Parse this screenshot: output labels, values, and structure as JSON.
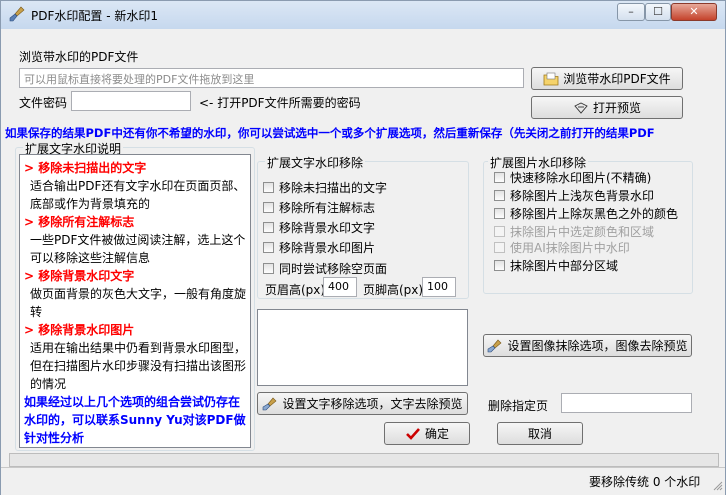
{
  "window": {
    "title": "PDF水印配置 - 新水印1",
    "controls": {
      "minimize": "–",
      "maximize": "☐",
      "close": "✕"
    }
  },
  "file": {
    "label": "浏览带水印的PDF文件",
    "placeholder": "可以用鼠标直接将要处理的PDF文件拖放到这里",
    "browse_button": "浏览带水印PDF文件",
    "password_label": "文件密码",
    "password_value": "",
    "password_hint": "<- 打开PDF文件所需要的密码",
    "preview_button": "打开预览"
  },
  "banner": "如果保存的结果PDF中还有你不希望的水印，你可以尝试选中一个或多个扩展选项，然后重新保存（先关闭之前打开的结果PDF",
  "description": {
    "group_title": "扩展文字水印说明",
    "sections": [
      {
        "heading": "> 移除未扫描出的文字",
        "text": "适合输出PDF还有文字水印在页面页部、底部或作为背景填充的"
      },
      {
        "heading": "> 移除所有注解标志",
        "text": "一些PDF文件被做过阅读注解，选上这个可以移除这些注解信息"
      },
      {
        "heading": "> 移除背景水印文字",
        "text": "做页面背景的灰色大文字，一般有角度旋转"
      },
      {
        "heading": "> 移除背景水印图片",
        "text": "适用在输出结果中仍看到背景水印图型，但在扫描图片水印步骤没有扫描出该图形的情况"
      }
    ],
    "contact": "如果经过以上几个选项的组合尝试仍存在水印的，可以联系Sunny Yu对该PDF做针对性分析"
  },
  "text_options": {
    "group_title": "扩展文字水印移除",
    "items": [
      {
        "label": "移除未扫描出的文字",
        "checked": false
      },
      {
        "label": "移除所有注解标志",
        "checked": false
      },
      {
        "label": "移除背景水印文字",
        "checked": false
      },
      {
        "label": "移除背景水印图片",
        "checked": false
      },
      {
        "label": "同时尝试移除空页面",
        "checked": false
      }
    ],
    "header_label": "页眉高(px)",
    "header_value": "400",
    "footer_label": "页脚高(px)",
    "footer_value": "100",
    "preview_button": "设置文字移除选项，文字去除预览"
  },
  "image_options": {
    "group_title": "扩展图片水印移除",
    "items": [
      {
        "label": "快速移除水印图片(不精确)",
        "checked": false,
        "enabled": true
      },
      {
        "label": "移除图片上浅灰色背景水印",
        "checked": false,
        "enabled": true
      },
      {
        "label": "移除图片上除灰黑色之外的颜色",
        "checked": false,
        "enabled": true
      },
      {
        "label": "抹除图片中选定颜色和区域",
        "checked": false,
        "enabled": false
      },
      {
        "label": "使用AI抹除图片中水印",
        "checked": false,
        "enabled": false
      },
      {
        "label": "抹除图片中部分区域",
        "checked": false,
        "enabled": true
      }
    ],
    "preview_button": "设置图像抹除选项，图像去除预览"
  },
  "delete_pages": {
    "label": "删除指定页",
    "value": ""
  },
  "actions": {
    "ok": "确定",
    "cancel": "取消"
  },
  "status": {
    "text": "要移除传统 0 个水印"
  },
  "colors": {
    "accent_red": "#ff0000",
    "accent_blue": "#0000ff",
    "ok_check": "#cc0000"
  }
}
